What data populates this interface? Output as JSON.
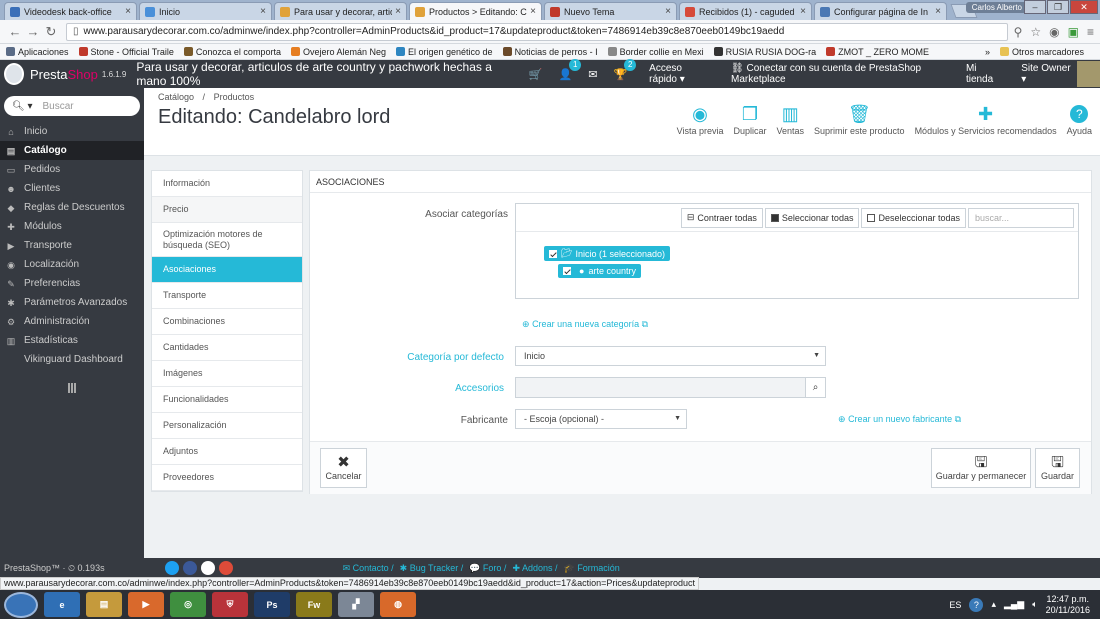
{
  "browser": {
    "tabs": [
      {
        "title": "Videodesk back-office",
        "color": "#3b6fb8"
      },
      {
        "title": "Inicio",
        "color": "#4a90d9"
      },
      {
        "title": "Para usar y decorar, artic",
        "color": "#e0a23a"
      },
      {
        "title": "Productos > Editando: C",
        "color": "#e0a23a",
        "active": true
      },
      {
        "title": "Nuevo Tema",
        "color": "#c0392b"
      },
      {
        "title": "Recibidos (1) - caguded",
        "color": "#d64a3a"
      },
      {
        "title": "Configurar página de In",
        "color": "#4a78b4"
      }
    ],
    "window_user": "Carlos Alberto",
    "url_host": "www.parausarydecorar.com.co",
    "url_path": "/adminwe/index.php?controller=AdminProducts&id_product=17&updateproduct&token=7486914eb39c8e870eeb0149bc19aedd",
    "bookmarks": [
      {
        "label": "Aplicaciones",
        "color": "#5a6b86"
      },
      {
        "label": "Stone - Official Traile",
        "color": "#c0392b"
      },
      {
        "label": "Conozca el comporta",
        "color": "#7a5a2a"
      },
      {
        "label": "Ovejero Alemán Neg",
        "color": "#e67e22"
      },
      {
        "label": "El origen genético de",
        "color": "#2e86c1"
      },
      {
        "label": "Noticias de perros - I",
        "color": "#6b4a2a"
      },
      {
        "label": "Border collie en Mexi",
        "color": "#888888"
      },
      {
        "label": "RUSIA RUSIA DOG-ra",
        "color": "#333333"
      },
      {
        "label": "ZMOT _ ZERO MOME",
        "color": "#c0392b"
      }
    ],
    "bookmarks_more": "»",
    "bookmarks_other": "Otros marcadores"
  },
  "header": {
    "brand_a": "Presta",
    "brand_b": "Shop",
    "version": "1.6.1.9",
    "store_title": "Para usar y decorar, articulos de arte country y pachwork hechas a mano 100%",
    "badge_customers": "1",
    "badge_trophy": "2",
    "quick_access": "Acceso rápido ▾",
    "connect": "Conectar con su cuenta de PrestaShop Marketplace",
    "my_shop": "Mi tienda",
    "site_owner": "Site Owner ▾"
  },
  "sidebar": {
    "search_placeholder": "Buscar",
    "items": [
      {
        "label": "Inicio",
        "icon": "⌂"
      },
      {
        "label": "Catálogo",
        "icon": "▤",
        "active": true
      },
      {
        "label": "Pedidos",
        "icon": "▭"
      },
      {
        "label": "Clientes",
        "icon": "☻"
      },
      {
        "label": "Reglas de Descuentos",
        "icon": "◆"
      },
      {
        "label": "Módulos",
        "icon": "✚"
      },
      {
        "label": "Transporte",
        "icon": "▶"
      },
      {
        "label": "Localización",
        "icon": "◉"
      },
      {
        "label": "Preferencias",
        "icon": "✎"
      },
      {
        "label": "Parámetros Avanzados",
        "icon": "✱"
      },
      {
        "label": "Administración",
        "icon": "⚙"
      },
      {
        "label": "Estadísticas",
        "icon": "▥"
      },
      {
        "label": "Vikinguard Dashboard",
        "icon": ""
      }
    ]
  },
  "page": {
    "breadcrumb_1": "Catálogo",
    "breadcrumb_sep": "/",
    "breadcrumb_2": "Productos",
    "title": "Editando: Candelabro lord",
    "toolbar": [
      {
        "label": "Vista previa",
        "icon": "◉"
      },
      {
        "label": "Duplicar",
        "icon": "❐"
      },
      {
        "label": "Ventas",
        "icon": "▥"
      },
      {
        "label": "Suprimir este producto",
        "icon": "🗑"
      },
      {
        "label": "Módulos y Servicios recomendados",
        "icon": "✚"
      },
      {
        "label": "Ayuda",
        "icon": "?"
      }
    ]
  },
  "product_tabs": [
    {
      "label": "Información"
    },
    {
      "label": "Precio",
      "shaded": true
    },
    {
      "label": "Optimización motores de búsqueda (SEO)",
      "tall": true
    },
    {
      "label": "Asociaciones",
      "active": true
    },
    {
      "label": "Transporte"
    },
    {
      "label": "Combinaciones"
    },
    {
      "label": "Cantidades"
    },
    {
      "label": "Imágenes"
    },
    {
      "label": "Funcionalidades"
    },
    {
      "label": "Personalización"
    },
    {
      "label": "Adjuntos"
    },
    {
      "label": "Proveedores"
    }
  ],
  "associations": {
    "heading": "ASOCIACIONES",
    "assoc_categories_label": "Asociar categorías",
    "collapse_all": "Contraer todas",
    "select_all": "Seleccionar todas",
    "deselect_all": "Deseleccionar todas",
    "cat_search_placeholder": "buscar...",
    "tree_root": "Inicio (1 seleccionado)",
    "tree_child": "arte country",
    "new_category": "Crear una nueva categoría",
    "default_category_label": "Categoría por defecto",
    "default_category_value": "Inicio",
    "accessories_label": "Accesorios",
    "manufacturer_label": "Fabricante",
    "manufacturer_value": "- Escoja (opcional) -",
    "new_manufacturer": "Crear un nuevo fabricante",
    "cancel": "Cancelar",
    "save_stay": "Guardar y permanecer",
    "save": "Guardar"
  },
  "footer": {
    "left": "PrestaShop™ · ⏲ 0.193s",
    "links": [
      "✉ Contacto /",
      "✱ Bug Tracker /",
      "💬 Foro /",
      "✚ Addons /",
      "🎓 Formación"
    ]
  },
  "status_url": "www.parausarydecorar.com.co/adminwe/index.php?controller=AdminProducts&token=7486914eb39c8e870eeb0149bc19aedd&id_product=17&action=Prices&updateproduct",
  "taskbar": {
    "apps": [
      {
        "label": "e",
        "color": "#2f6fb5"
      },
      {
        "label": "▤",
        "color": "#c59a3c"
      },
      {
        "label": "▶",
        "color": "#d9692c"
      },
      {
        "label": "◎",
        "color": "#3f8f3f"
      },
      {
        "label": "⛨",
        "color": "#b8333a"
      },
      {
        "label": "Ps",
        "color": "#1f3c68"
      },
      {
        "label": "Fw",
        "color": "#8a7a1a"
      },
      {
        "label": "▞",
        "color": "#7c8796"
      },
      {
        "label": "◍",
        "color": "#d8692a"
      }
    ],
    "lang": "ES",
    "time": "12:47 p.m.",
    "date": "20/11/2016"
  }
}
